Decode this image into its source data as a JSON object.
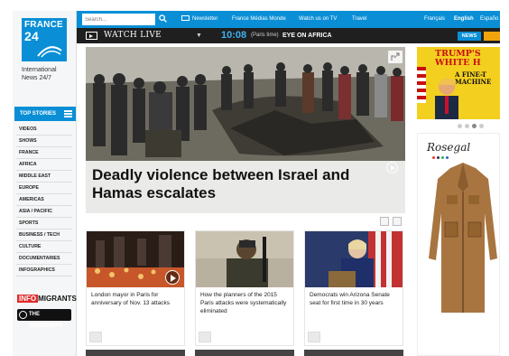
{
  "brand": {
    "logo_line1": "FRANCE",
    "logo_line2": "24",
    "tagline_line1": "International",
    "tagline_line2": "News 24/7"
  },
  "search": {
    "placeholder": "Search..."
  },
  "topnav": {
    "newsletter": "Newsletter",
    "france_medias_monde": "France Médias Monde",
    "watch_on_tv": "Watch us on TV",
    "travel": "Travel",
    "languages": [
      "Français",
      "English",
      "Españo"
    ],
    "active_language": "English"
  },
  "livebar": {
    "watch_live": "WATCH LIVE",
    "time": "10:08",
    "timezone": "(Paris time)",
    "program": "EYE ON AFRICA",
    "news_tab": "NEWS"
  },
  "sidebar": {
    "top_stories": "TOP STORIES",
    "items": [
      "VIDEOS",
      "SHOWS",
      "FRANCE",
      "AFRICA",
      "MIDDLE EAST",
      "EUROPE",
      "AMERICAS",
      "ASIA / PACIFIC",
      "SPORTS",
      "BUSINESS / TECH",
      "CULTURE",
      "DOCUMENTARIES",
      "INFOGRAPHICS"
    ],
    "infomigrants_info": "INFO",
    "infomigrants_rest": "MIGRANTS",
    "observers": "THE OBSERVERS"
  },
  "hero": {
    "title": "Deadly violence between Israel and Hamas escalates"
  },
  "cards": [
    {
      "title": "London mayor in Paris for anniversary of Nov. 13 attacks",
      "has_video": true
    },
    {
      "title": "How the planners of the 2015 Paris attacks were systematically eliminated",
      "has_video": false
    },
    {
      "title": "Democrats win Arizona Senate seat for first time in 30 years",
      "has_video": false
    }
  ],
  "ads": {
    "ad1_line1": "TRUMP'S",
    "ad1_line2": "WHITE H",
    "ad1_line3": "A FINE-T",
    "ad1_line4": "MACHINE",
    "ad2_brand": "Rosegal"
  },
  "colors": {
    "brand_blue": "#0a8fd6",
    "live_bar": "#1f1f1f",
    "ad_yellow": "#f3cf1f"
  }
}
